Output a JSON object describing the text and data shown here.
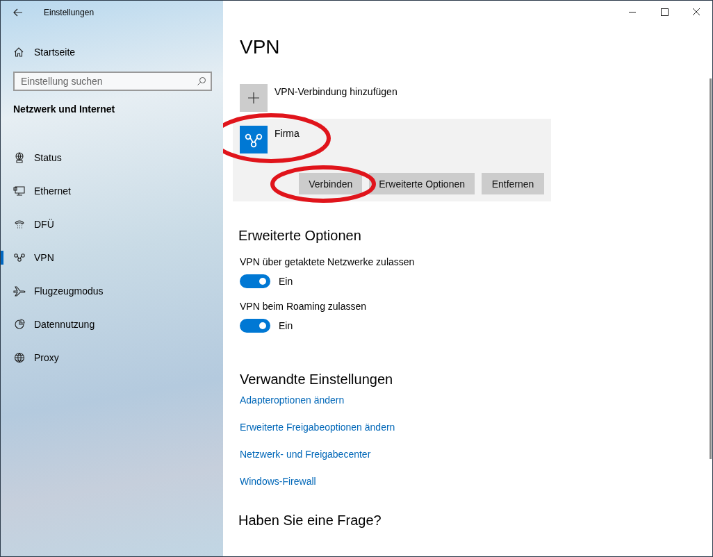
{
  "window": {
    "title": "Einstellungen"
  },
  "sidebar": {
    "home": "Startseite",
    "search": {
      "placeholder": "Einstellung suchen"
    },
    "section": "Netzwerk und Internet",
    "items": [
      {
        "label": "Status",
        "kind": "status",
        "selected": false
      },
      {
        "label": "Ethernet",
        "kind": "ethernet",
        "selected": false
      },
      {
        "label": "DFÜ",
        "kind": "dialup",
        "selected": false
      },
      {
        "label": "VPN",
        "kind": "vpn",
        "selected": true
      },
      {
        "label": "Flugzeugmodus",
        "kind": "airplane",
        "selected": false
      },
      {
        "label": "Datennutzung",
        "kind": "data",
        "selected": false
      },
      {
        "label": "Proxy",
        "kind": "proxy",
        "selected": false
      }
    ]
  },
  "page": {
    "title": "VPN",
    "add_connection": "VPN-Verbindung hinzufügen",
    "connections": [
      {
        "name": "Firma",
        "buttons": [
          "Verbinden",
          "Erweiterte Optionen",
          "Entfernen"
        ]
      }
    ],
    "advanced": {
      "heading": "Erweiterte Optionen",
      "toggles": [
        {
          "label": "VPN über getaktete Netzwerke zulassen",
          "on": true,
          "state_text": "Ein"
        },
        {
          "label": "VPN beim Roaming zulassen",
          "on": true,
          "state_text": "Ein"
        }
      ]
    },
    "related": {
      "heading": "Verwandte Einstellungen",
      "links": [
        "Adapteroptionen ändern",
        "Erweiterte Freigabeoptionen ändern",
        "Netzwerk- und Freigabecenter",
        "Windows-Firewall"
      ]
    },
    "question": {
      "heading": "Haben Sie eine Frage?"
    }
  }
}
